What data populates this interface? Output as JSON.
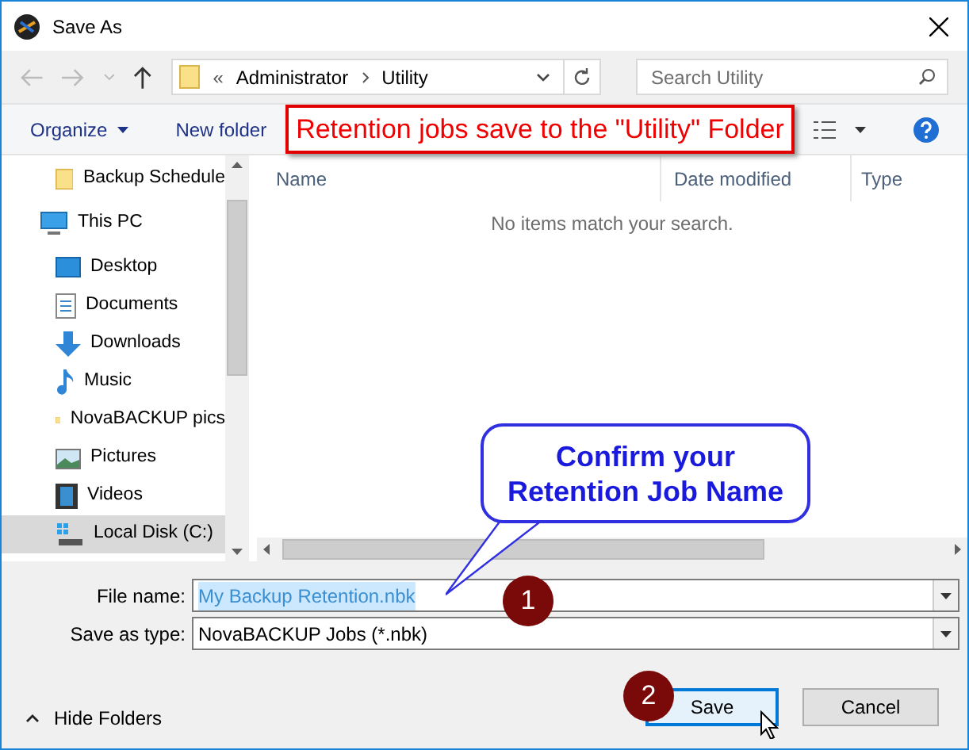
{
  "window": {
    "title": "Save As"
  },
  "address": {
    "crumbs": [
      "«",
      "Administrator",
      "Utility"
    ]
  },
  "search": {
    "placeholder": "Search Utility"
  },
  "toolbar": {
    "organize": "Organize",
    "new_folder": "New folder"
  },
  "annotation_banner": "Retention jobs save to the \"Utility\" Folder",
  "sidebar": {
    "items": [
      {
        "children": [
          {
            "label": "Backup Schedule",
            "kind": "folder",
            "selected": false
          }
        ]
      },
      {
        "label": "This PC",
        "kind": "pc",
        "selected": false,
        "children": [
          {
            "label": "Desktop",
            "kind": "desktop",
            "selected": false
          },
          {
            "label": "Documents",
            "kind": "documents",
            "selected": false
          },
          {
            "label": "Downloads",
            "kind": "downloads",
            "selected": false
          },
          {
            "label": "Music",
            "kind": "music",
            "selected": false
          },
          {
            "label": "NovaBACKUP pics",
            "kind": "folder",
            "selected": false
          },
          {
            "label": "Pictures",
            "kind": "pictures",
            "selected": false
          },
          {
            "label": "Videos",
            "kind": "videos",
            "selected": false
          },
          {
            "label": "Local Disk (C:)",
            "kind": "drive",
            "selected": true
          }
        ]
      }
    ]
  },
  "table": {
    "columns": [
      "Name",
      "Date modified",
      "Type"
    ],
    "empty_message": "No items match your search."
  },
  "callout": {
    "text": "Confirm your Retention Job Name"
  },
  "file_name": {
    "label": "File name:",
    "value": "My Backup Retention.nbk"
  },
  "save_as_type": {
    "label": "Save as type:",
    "value": "NovaBACKUP Jobs (*.nbk)"
  },
  "steps": [
    "1",
    "2"
  ],
  "hide_folders": "Hide Folders",
  "buttons": {
    "save": "Save",
    "cancel": "Cancel"
  }
}
